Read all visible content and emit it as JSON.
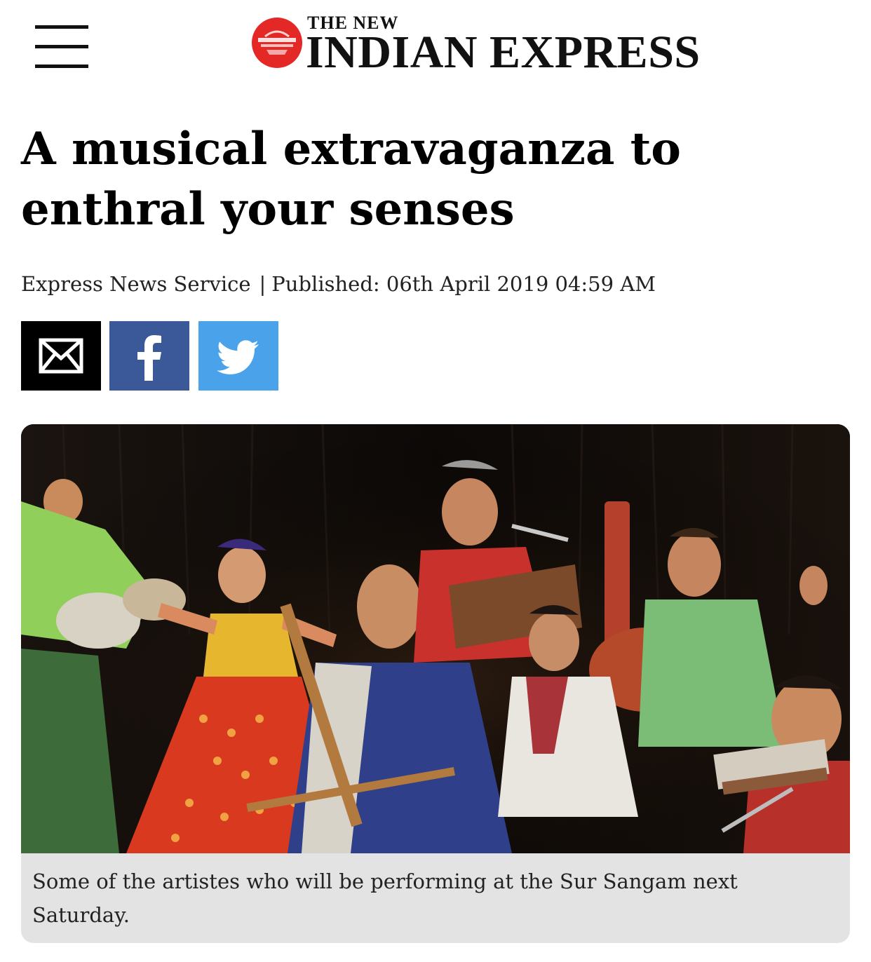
{
  "header": {
    "menu_icon": "hamburger-menu-icon",
    "logo_small": "THE NEW",
    "logo_big": "INDIAN EXPRESS",
    "logo_color": "#e32826"
  },
  "article": {
    "headline": "A musical extravaganza to enthral your senses",
    "author": "Express News Service",
    "separator": "|",
    "published": "Published: 06th April 2019 04:59 AM"
  },
  "share": {
    "email_icon": "envelope-icon",
    "facebook_icon": "facebook-icon",
    "twitter_icon": "twitter-icon",
    "colors": {
      "email": "#000000",
      "facebook": "#3b5998",
      "twitter": "#4aa3ea"
    }
  },
  "figure": {
    "caption": "Some of the artistes who will be performing at the Sur Sangam next Saturday."
  }
}
